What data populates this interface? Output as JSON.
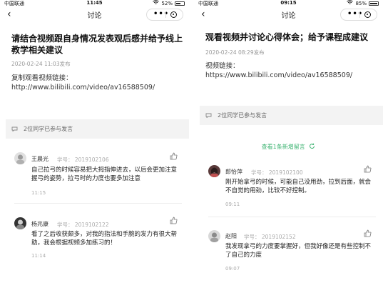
{
  "left": {
    "status": {
      "carrier": "中国联通",
      "time": "11:45",
      "battery": "52%"
    },
    "nav": {
      "title": "讨论",
      "dots": "•••"
    },
    "post": {
      "title": "请结合视频跟自身情况发表观后感并给予线上教学相关建议",
      "date": "2020-02-24 11:03发布",
      "text": "复制观看视频链接：\nhttp://www.bilibili.com/video/av16588509/"
    },
    "participants": "2位同学已参与发言",
    "comments": [
      {
        "name": "王晨光",
        "id": "学号： 2019102106",
        "text": "自己拉弓的时候容易把大拇指伸进去，以后会更加注意握弓的姿势，拉弓时的力度也要多加注意",
        "time": "11:15"
      },
      {
        "name": "杨兆康",
        "id": "学号： 2019102122",
        "text": "看了之后收获颇多，对我的指法和手腕的发力有很大帮助，我会根据视频多加练习的！",
        "time": "11:14"
      }
    ]
  },
  "right": {
    "status": {
      "carrier": "中国联通",
      "time": "09:15",
      "battery": "85%"
    },
    "nav": {
      "title": "讨论",
      "dots": "•••"
    },
    "post": {
      "title": "观看视频并讨论心得体会；给予课程成建议",
      "date": "2020-02-24 08:29发布",
      "text": "视频链接：\nhttps://www.bilibili.com/video/av16588509/"
    },
    "participants": "2位同学已参与发言",
    "new_notice": "查看1条新增留言",
    "comments": [
      {
        "name": "郎怡萍",
        "id": "学号： 2019102100",
        "text": "刚开始拿弓的时候，可能自己没用劲，拉到后面，就会不自觉的用劲，比较不好控制。",
        "time": "09:11"
      },
      {
        "name": "赵阳",
        "id": "学号： 2019102152",
        "text": "我发现拿弓的力度要掌握好，但我好像还是有些控制不了自己的力度",
        "time": "09:07"
      }
    ]
  },
  "colors": {
    "accent_green": "#3cb371",
    "muted": "#999999",
    "bar_bg": "#f3f3f3"
  },
  "icons": [
    "back-arrow-icon",
    "more-dots-icon",
    "target-close-icon",
    "wifi-icon",
    "signal-icon",
    "battery-icon",
    "comment-icon",
    "thumbs-up-icon",
    "refresh-icon"
  ]
}
